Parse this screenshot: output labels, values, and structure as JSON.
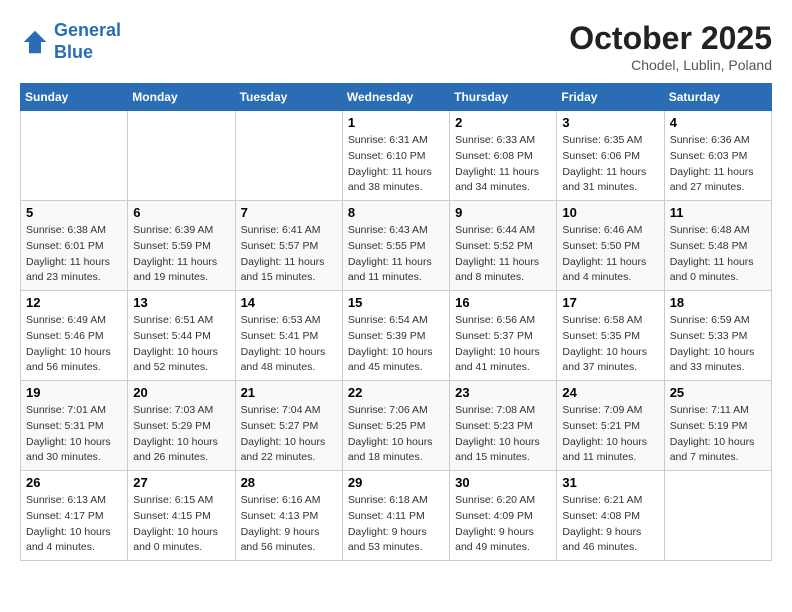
{
  "header": {
    "logo_line1": "General",
    "logo_line2": "Blue",
    "month": "October 2025",
    "location": "Chodel, Lublin, Poland"
  },
  "days_of_week": [
    "Sunday",
    "Monday",
    "Tuesday",
    "Wednesday",
    "Thursday",
    "Friday",
    "Saturday"
  ],
  "weeks": [
    [
      {
        "day": "",
        "info": ""
      },
      {
        "day": "",
        "info": ""
      },
      {
        "day": "",
        "info": ""
      },
      {
        "day": "1",
        "info": "Sunrise: 6:31 AM\nSunset: 6:10 PM\nDaylight: 11 hours\nand 38 minutes."
      },
      {
        "day": "2",
        "info": "Sunrise: 6:33 AM\nSunset: 6:08 PM\nDaylight: 11 hours\nand 34 minutes."
      },
      {
        "day": "3",
        "info": "Sunrise: 6:35 AM\nSunset: 6:06 PM\nDaylight: 11 hours\nand 31 minutes."
      },
      {
        "day": "4",
        "info": "Sunrise: 6:36 AM\nSunset: 6:03 PM\nDaylight: 11 hours\nand 27 minutes."
      }
    ],
    [
      {
        "day": "5",
        "info": "Sunrise: 6:38 AM\nSunset: 6:01 PM\nDaylight: 11 hours\nand 23 minutes."
      },
      {
        "day": "6",
        "info": "Sunrise: 6:39 AM\nSunset: 5:59 PM\nDaylight: 11 hours\nand 19 minutes."
      },
      {
        "day": "7",
        "info": "Sunrise: 6:41 AM\nSunset: 5:57 PM\nDaylight: 11 hours\nand 15 minutes."
      },
      {
        "day": "8",
        "info": "Sunrise: 6:43 AM\nSunset: 5:55 PM\nDaylight: 11 hours\nand 11 minutes."
      },
      {
        "day": "9",
        "info": "Sunrise: 6:44 AM\nSunset: 5:52 PM\nDaylight: 11 hours\nand 8 minutes."
      },
      {
        "day": "10",
        "info": "Sunrise: 6:46 AM\nSunset: 5:50 PM\nDaylight: 11 hours\nand 4 minutes."
      },
      {
        "day": "11",
        "info": "Sunrise: 6:48 AM\nSunset: 5:48 PM\nDaylight: 11 hours\nand 0 minutes."
      }
    ],
    [
      {
        "day": "12",
        "info": "Sunrise: 6:49 AM\nSunset: 5:46 PM\nDaylight: 10 hours\nand 56 minutes."
      },
      {
        "day": "13",
        "info": "Sunrise: 6:51 AM\nSunset: 5:44 PM\nDaylight: 10 hours\nand 52 minutes."
      },
      {
        "day": "14",
        "info": "Sunrise: 6:53 AM\nSunset: 5:41 PM\nDaylight: 10 hours\nand 48 minutes."
      },
      {
        "day": "15",
        "info": "Sunrise: 6:54 AM\nSunset: 5:39 PM\nDaylight: 10 hours\nand 45 minutes."
      },
      {
        "day": "16",
        "info": "Sunrise: 6:56 AM\nSunset: 5:37 PM\nDaylight: 10 hours\nand 41 minutes."
      },
      {
        "day": "17",
        "info": "Sunrise: 6:58 AM\nSunset: 5:35 PM\nDaylight: 10 hours\nand 37 minutes."
      },
      {
        "day": "18",
        "info": "Sunrise: 6:59 AM\nSunset: 5:33 PM\nDaylight: 10 hours\nand 33 minutes."
      }
    ],
    [
      {
        "day": "19",
        "info": "Sunrise: 7:01 AM\nSunset: 5:31 PM\nDaylight: 10 hours\nand 30 minutes."
      },
      {
        "day": "20",
        "info": "Sunrise: 7:03 AM\nSunset: 5:29 PM\nDaylight: 10 hours\nand 26 minutes."
      },
      {
        "day": "21",
        "info": "Sunrise: 7:04 AM\nSunset: 5:27 PM\nDaylight: 10 hours\nand 22 minutes."
      },
      {
        "day": "22",
        "info": "Sunrise: 7:06 AM\nSunset: 5:25 PM\nDaylight: 10 hours\nand 18 minutes."
      },
      {
        "day": "23",
        "info": "Sunrise: 7:08 AM\nSunset: 5:23 PM\nDaylight: 10 hours\nand 15 minutes."
      },
      {
        "day": "24",
        "info": "Sunrise: 7:09 AM\nSunset: 5:21 PM\nDaylight: 10 hours\nand 11 minutes."
      },
      {
        "day": "25",
        "info": "Sunrise: 7:11 AM\nSunset: 5:19 PM\nDaylight: 10 hours\nand 7 minutes."
      }
    ],
    [
      {
        "day": "26",
        "info": "Sunrise: 6:13 AM\nSunset: 4:17 PM\nDaylight: 10 hours\nand 4 minutes."
      },
      {
        "day": "27",
        "info": "Sunrise: 6:15 AM\nSunset: 4:15 PM\nDaylight: 10 hours\nand 0 minutes."
      },
      {
        "day": "28",
        "info": "Sunrise: 6:16 AM\nSunset: 4:13 PM\nDaylight: 9 hours\nand 56 minutes."
      },
      {
        "day": "29",
        "info": "Sunrise: 6:18 AM\nSunset: 4:11 PM\nDaylight: 9 hours\nand 53 minutes."
      },
      {
        "day": "30",
        "info": "Sunrise: 6:20 AM\nSunset: 4:09 PM\nDaylight: 9 hours\nand 49 minutes."
      },
      {
        "day": "31",
        "info": "Sunrise: 6:21 AM\nSunset: 4:08 PM\nDaylight: 9 hours\nand 46 minutes."
      },
      {
        "day": "",
        "info": ""
      }
    ]
  ]
}
